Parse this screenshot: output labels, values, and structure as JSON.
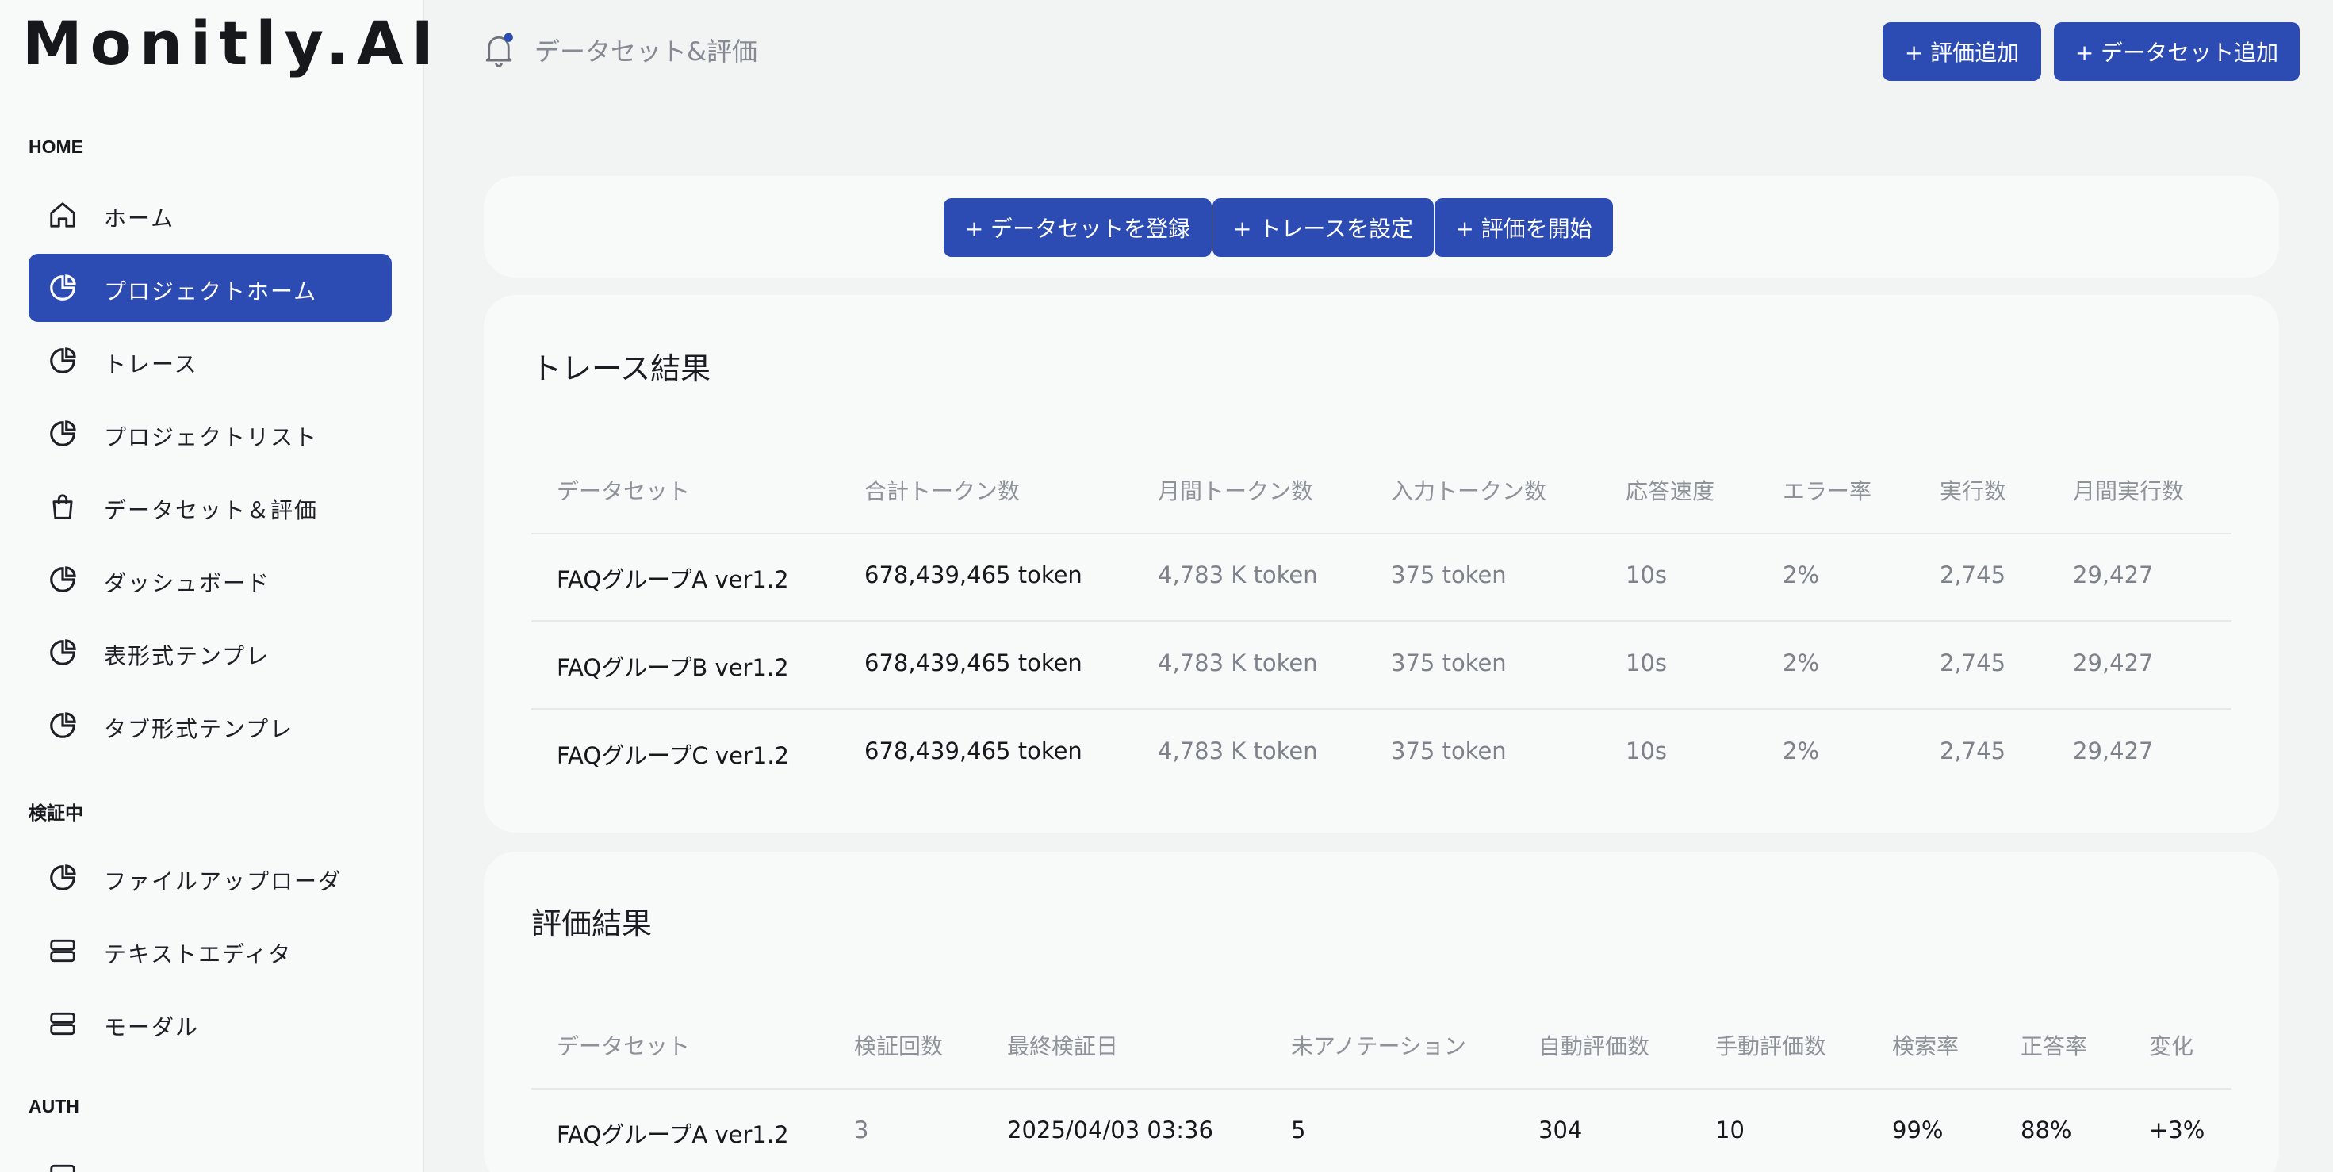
{
  "app": {
    "logo": "Monitly.AI"
  },
  "sidebar": {
    "sections": [
      {
        "label": "HOME"
      },
      {
        "label": "検証中"
      },
      {
        "label": "AUTH"
      }
    ],
    "items": [
      {
        "label": "ホーム",
        "icon": "home-icon"
      },
      {
        "label": "プロジェクトホーム",
        "icon": "pie-chart-icon",
        "active": true
      },
      {
        "label": "トレース",
        "icon": "pie-chart-icon"
      },
      {
        "label": "プロジェクトリスト",
        "icon": "pie-chart-icon"
      },
      {
        "label": "データセット＆評価",
        "icon": "shopping-bag-icon"
      },
      {
        "label": "ダッシュボード",
        "icon": "pie-chart-icon"
      },
      {
        "label": "表形式テンプレ",
        "icon": "pie-chart-icon"
      },
      {
        "label": "タブ形式テンプレ",
        "icon": "pie-chart-icon"
      },
      {
        "label": "ファイルアップローダ",
        "icon": "pie-chart-icon"
      },
      {
        "label": "テキストエディタ",
        "icon": "server-icon"
      },
      {
        "label": "モーダル",
        "icon": "server-icon"
      }
    ]
  },
  "header": {
    "title": "データセット&評価",
    "buttons": {
      "add_eval": "+ 評価追加",
      "add_dataset": "+ データセット追加"
    }
  },
  "actions": {
    "register_dataset": "+ データセットを登録",
    "set_trace": "+ トレースを設定",
    "start_eval": "+ 評価を開始"
  },
  "trace": {
    "title": "トレース結果",
    "columns": [
      "データセット",
      "合計トークン数",
      "月間トークン数",
      "入力トークン数",
      "応答速度",
      "エラー率",
      "実行数",
      "月間実行数"
    ],
    "rows": [
      [
        "FAQグループA ver1.2",
        "678,439,465 token",
        "4,783 K token",
        "375 token",
        "10s",
        "2%",
        "2,745",
        "29,427"
      ],
      [
        "FAQグループB ver1.2",
        "678,439,465 token",
        "4,783 K token",
        "375 token",
        "10s",
        "2%",
        "2,745",
        "29,427"
      ],
      [
        "FAQグループC ver1.2",
        "678,439,465 token",
        "4,783 K token",
        "375 token",
        "10s",
        "2%",
        "2,745",
        "29,427"
      ]
    ]
  },
  "eval": {
    "title": "評価結果",
    "columns": [
      "データセット",
      "検証回数",
      "最終検証日",
      "未アノテーション",
      "自動評価数",
      "手動評価数",
      "検索率",
      "正答率",
      "変化"
    ],
    "rows": [
      [
        "FAQグループA ver1.2",
        "3",
        "2025/04/03 03:36",
        "5",
        "304",
        "10",
        "99%",
        "88%",
        "+3%"
      ]
    ]
  },
  "colors": {
    "accent": "#2c4bb3",
    "notification_dot": "#2c4bb3"
  }
}
